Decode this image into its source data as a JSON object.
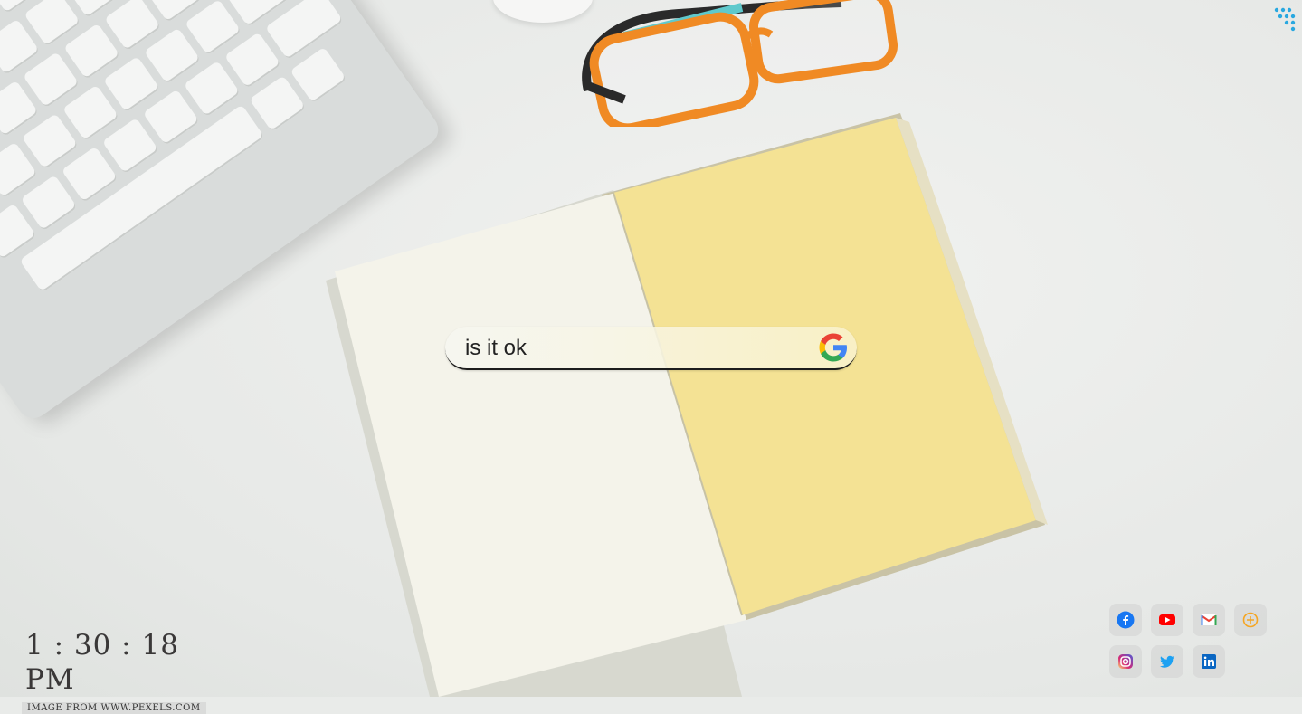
{
  "search": {
    "value": "is it ok",
    "engine_icon": "google-g-icon"
  },
  "launcher": {
    "icon": "apps-grid-icon",
    "color": "#29a8e0"
  },
  "clock": {
    "time": "1 : 30 : 18 PM",
    "credit": "Image from www.pexels.com"
  },
  "social_links": [
    {
      "name": "facebook",
      "icon": "facebook-icon",
      "color": "#1877f2"
    },
    {
      "name": "youtube",
      "icon": "youtube-icon",
      "color": "#ff0000"
    },
    {
      "name": "gmail",
      "icon": "gmail-icon",
      "color": "#ea4335"
    },
    {
      "name": "add",
      "icon": "add-circle-icon",
      "color": "#f5a623"
    },
    {
      "name": "instagram",
      "icon": "instagram-icon",
      "color": "#d6249f"
    },
    {
      "name": "twitter",
      "icon": "twitter-icon",
      "color": "#1da1f2"
    },
    {
      "name": "linkedin",
      "icon": "linkedin-icon",
      "color": "#0a66c2"
    }
  ]
}
